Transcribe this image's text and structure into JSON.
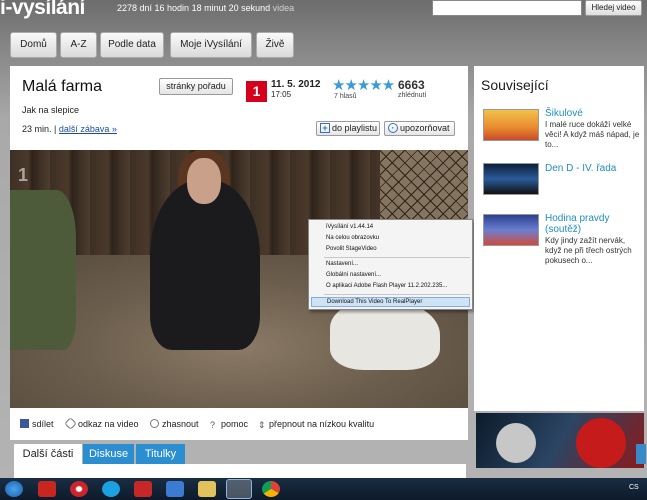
{
  "header": {
    "logo_text": "i-vysílání",
    "counter_text": "2278 dní 16 hodin 18 minut 20 sekund",
    "counter_suffix": "videa",
    "search": {
      "value": "",
      "button_label": "Hledej video"
    }
  },
  "nav": [
    "Domů",
    "A-Z",
    "Podle data",
    "Moje iVysílání",
    "Živě"
  ],
  "show": {
    "title": "Malá farma",
    "page_button": "stránky pořadu",
    "episode": "Jak na slepice",
    "duration": "23 min.",
    "separator": "|",
    "more_link": "další zábava »",
    "channel_logo": "1",
    "date": "11. 5. 2012",
    "time": "17:05",
    "rating_stars": "★★★★★",
    "rating_value": 4,
    "votes": "7 hlasů",
    "views": "6663",
    "views_label": "zhlédnutí",
    "playlist_button": "do playlistu",
    "notify_button": "upozorňovat"
  },
  "video": {
    "watermark": "1"
  },
  "context_menu": {
    "items": [
      "iVysílání v1.44.14",
      "Na celou obrazovku",
      "Povolit StageVideo",
      "Nastavení...",
      "Globální nastavení...",
      "O aplikaci Adobe Flash Player 11.2.202.235...",
      "Download This Video To RealPlayer"
    ],
    "highlighted_index": 6
  },
  "toolbar": {
    "share": "sdílet",
    "link": "odkaz na video",
    "dim": "zhasnout",
    "help": "pomoc",
    "quality": "přepnout na nízkou kvalitu"
  },
  "tabs": [
    "Další části",
    "Diskuse",
    "Titulky"
  ],
  "sidebar": {
    "title": "Související",
    "items": [
      {
        "title": "Šikulové",
        "desc": "I malé ruce dokáží velké věci! A když máš nápad, je to..."
      },
      {
        "title": "Den D - IV. řada",
        "desc": ""
      },
      {
        "title": "Hodina pravdy (soutěž)",
        "desc": "Kdy jindy zažít nervák, když ne při třech ostrých pokusech o..."
      }
    ]
  },
  "taskbar": {
    "tray": "CS"
  },
  "colors": {
    "accent_blue": "#1f8fbf",
    "tab_active": "#ffffff",
    "tab_inactive": "#2b8ed0",
    "ct_red": "#d6001c"
  }
}
